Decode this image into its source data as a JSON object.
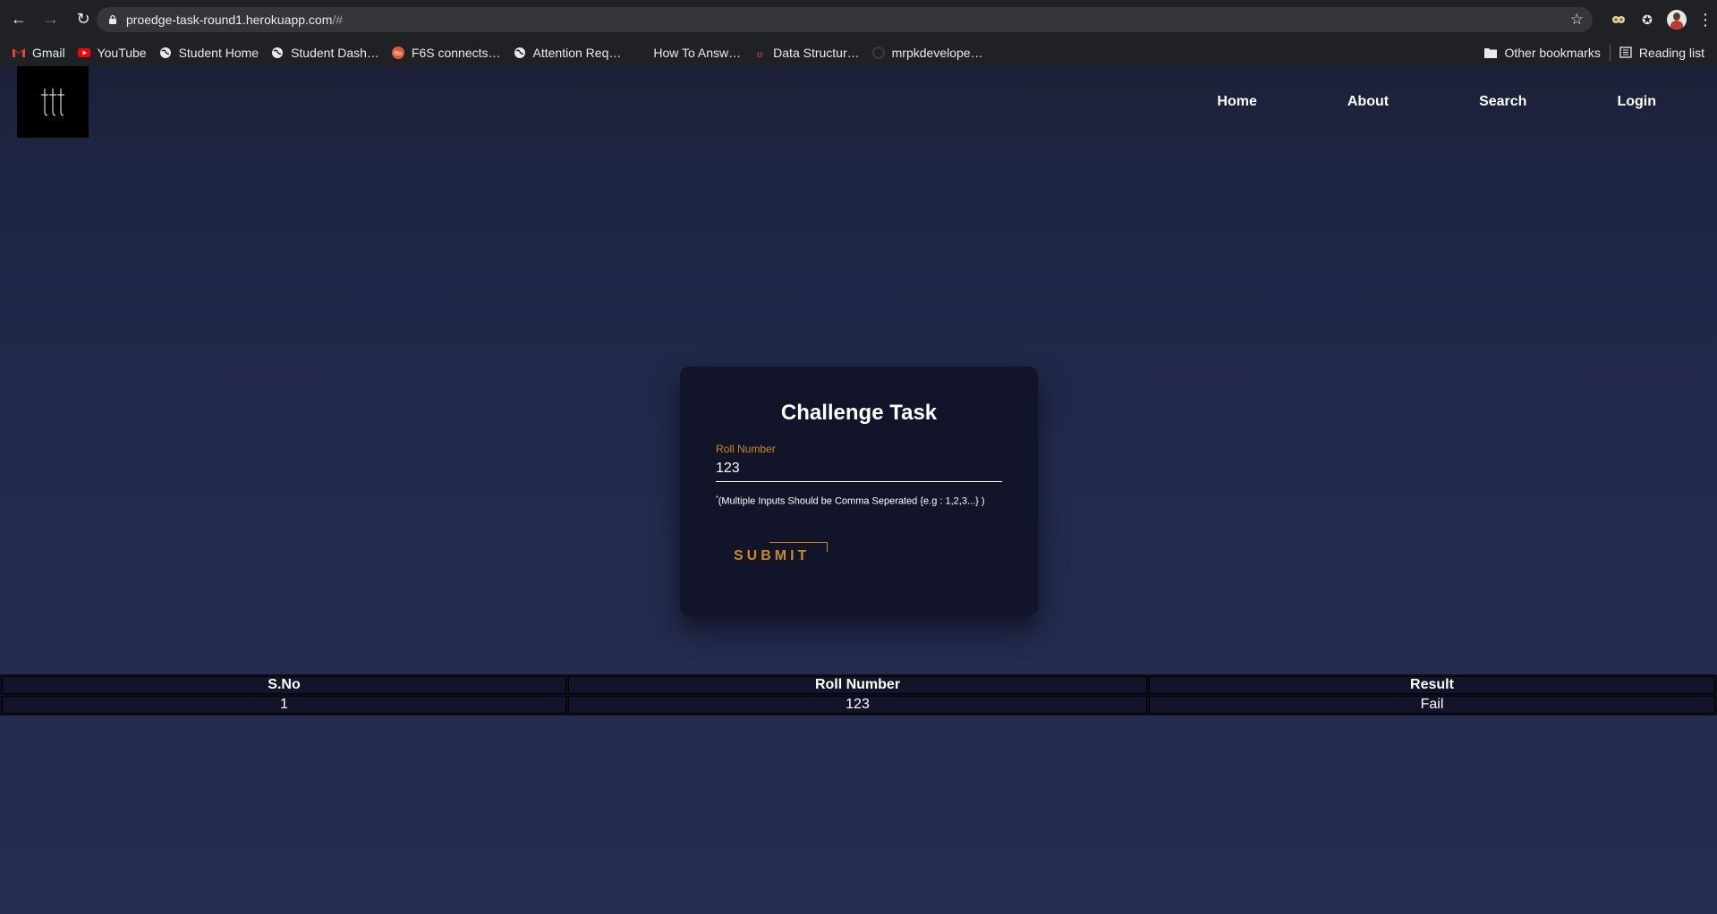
{
  "browser": {
    "url_host": "proedge-task-round1.herokuapp.com",
    "url_path": "/#",
    "bookmarks": [
      {
        "label": "Gmail",
        "icon": "gmail-icon"
      },
      {
        "label": "YouTube",
        "icon": "youtube-icon"
      },
      {
        "label": "Student Home",
        "icon": "globe-icon"
      },
      {
        "label": "Student Dash…",
        "icon": "globe-icon"
      },
      {
        "label": "F6S connects…",
        "icon": "f6s-icon"
      },
      {
        "label": "Attention Req…",
        "icon": "globe-icon"
      },
      {
        "label": "How To Answ…",
        "icon": "moon-icon"
      },
      {
        "label": "Data Structur…",
        "icon": "udemy-icon"
      },
      {
        "label": "mrpkdevelope…",
        "icon": "github-icon"
      }
    ],
    "other_bookmarks": "Other bookmarks",
    "reading_list": "Reading list"
  },
  "nav": {
    "home": "Home",
    "about": "About",
    "search": "Search",
    "login": "Login"
  },
  "form": {
    "title": "Challenge Task",
    "label": "Roll Number",
    "value": "123",
    "hint_mark": "*",
    "hint": "(Multiple Inputs Should be Comma Seperated {e.g : 1,2,3...} )",
    "submit": "SUBMIT"
  },
  "table": {
    "headers": [
      "S.No",
      "Roll Number",
      "Result"
    ],
    "rows": [
      [
        "1",
        "123",
        "Fail"
      ]
    ]
  },
  "colors": {
    "accent": "#c98a1e",
    "background": "#232b4d",
    "card": "#12152a"
  }
}
